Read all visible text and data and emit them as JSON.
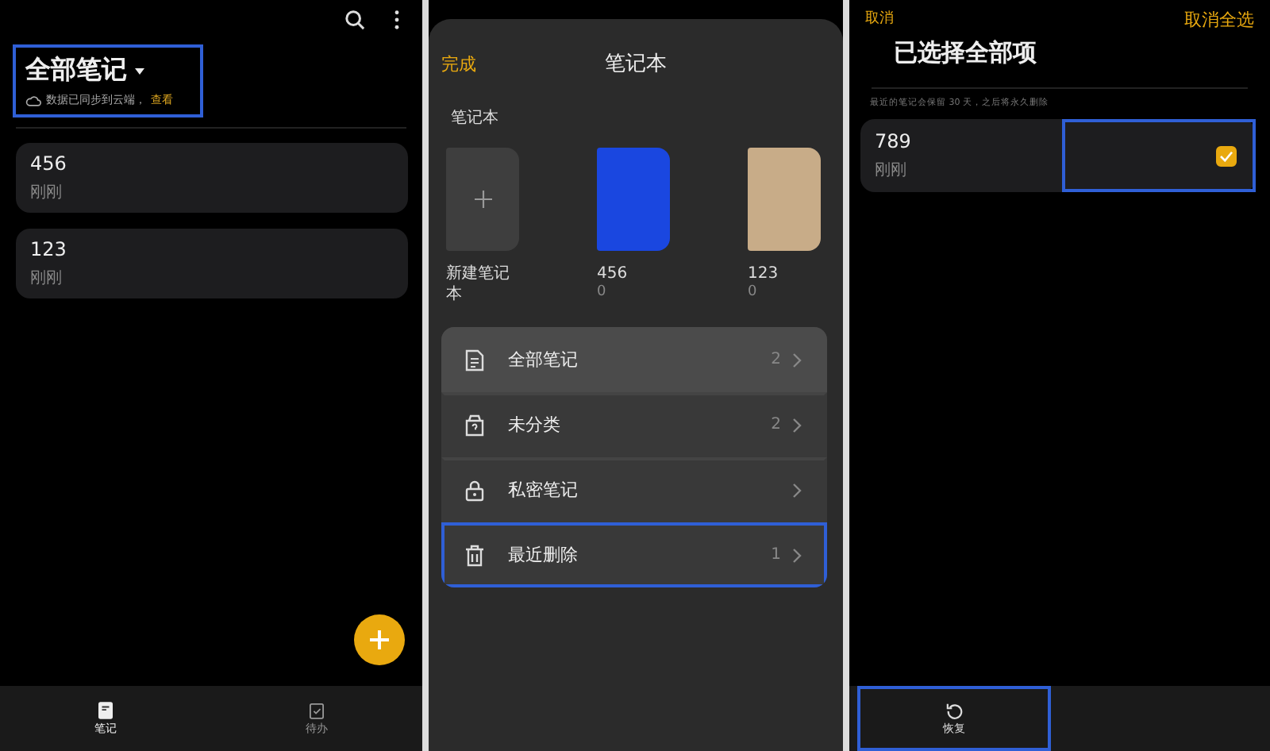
{
  "notes_screen": {
    "title": "全部笔记",
    "highlighted": true,
    "sync_text": "数据已同步到云端，",
    "sync_link": "查看",
    "notes": [
      {
        "title": "456",
        "time": "刚刚"
      },
      {
        "title": "123",
        "time": "刚刚"
      }
    ],
    "nav": [
      {
        "label": "笔记",
        "selected": true
      },
      {
        "label": "待办",
        "selected": false
      }
    ]
  },
  "notebook_sheet": {
    "done": "完成",
    "title": "笔记本",
    "section": "笔记本",
    "notebooks": [
      {
        "kind": "new",
        "name": "新建笔记本"
      },
      {
        "kind": "book",
        "name": "456",
        "count": "0",
        "color": "#1a47e0"
      },
      {
        "kind": "book",
        "name": "123",
        "count": "0",
        "color": "#c8ac88"
      }
    ],
    "menu": [
      {
        "label": "全部笔记",
        "count": "2",
        "selected": true,
        "highlighted": false
      },
      {
        "label": "未分类",
        "count": "2",
        "selected": false,
        "highlighted": false
      },
      {
        "label": "私密笔记",
        "selected": false,
        "highlighted": false
      },
      {
        "label": "最近删除",
        "count": "1",
        "selected": false,
        "highlighted": true
      }
    ]
  },
  "selection_screen": {
    "cancel": "取消",
    "deselect_all": "取消全选",
    "title": "已选择全部项",
    "notice": "最近的笔记会保留 30 天，之后将永久删除",
    "notes": [
      {
        "title": "789",
        "time": "刚刚",
        "checked": true,
        "highlighted": true
      }
    ],
    "actions": [
      {
        "label": "恢复",
        "highlighted": true
      }
    ]
  }
}
